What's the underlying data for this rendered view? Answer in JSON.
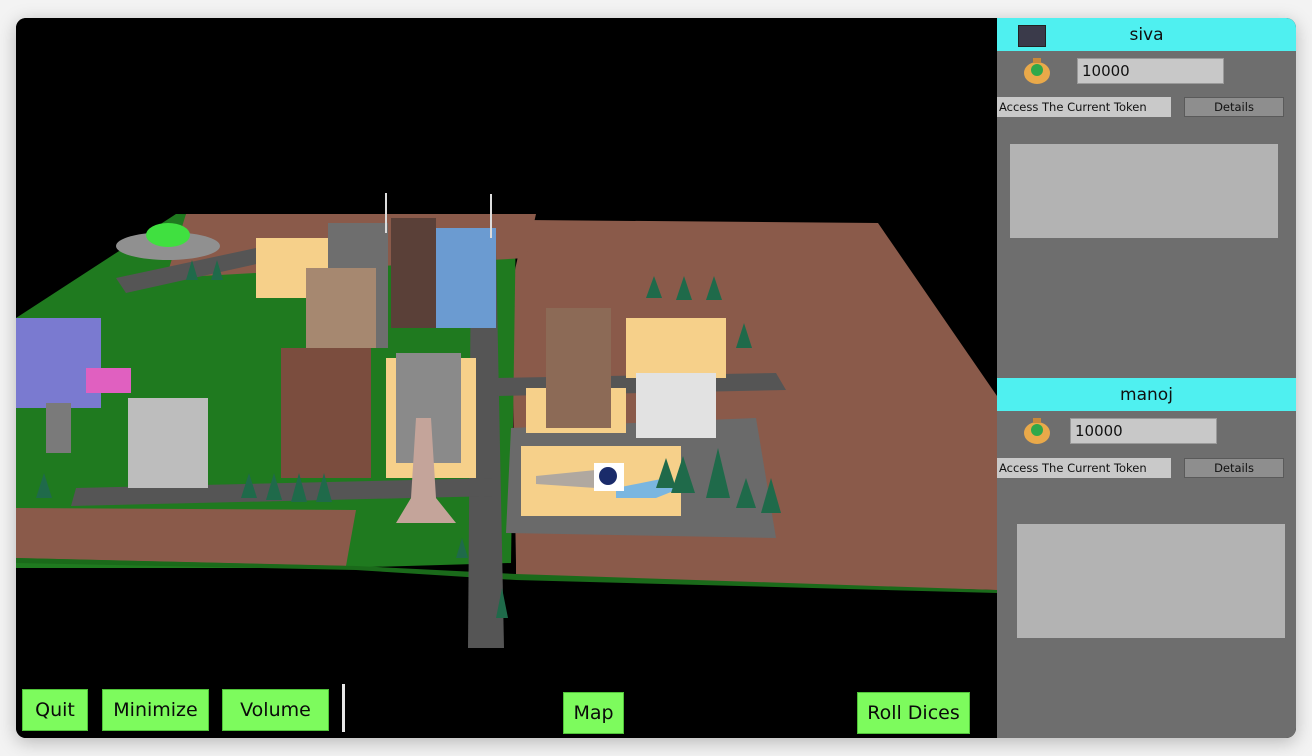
{
  "buttons": {
    "quit": "Quit",
    "minimize": "Minimize",
    "volume": "Volume",
    "map": "Map",
    "roll_dices": "Roll Dices"
  },
  "players": [
    {
      "name": "siva",
      "money": "10000",
      "token_label": "Access The Current Token",
      "details": "Details"
    },
    {
      "name": "manoj",
      "money": "10000",
      "token_label": "Access The Current Token",
      "details": "Details"
    }
  ],
  "colors": {
    "button_green": "#7dfb5d",
    "player_header": "#4ff0f0",
    "panel_bg": "#6e6e6e",
    "ground_brown": "#8a5a4a",
    "grass_green": "#1f7a1f"
  }
}
